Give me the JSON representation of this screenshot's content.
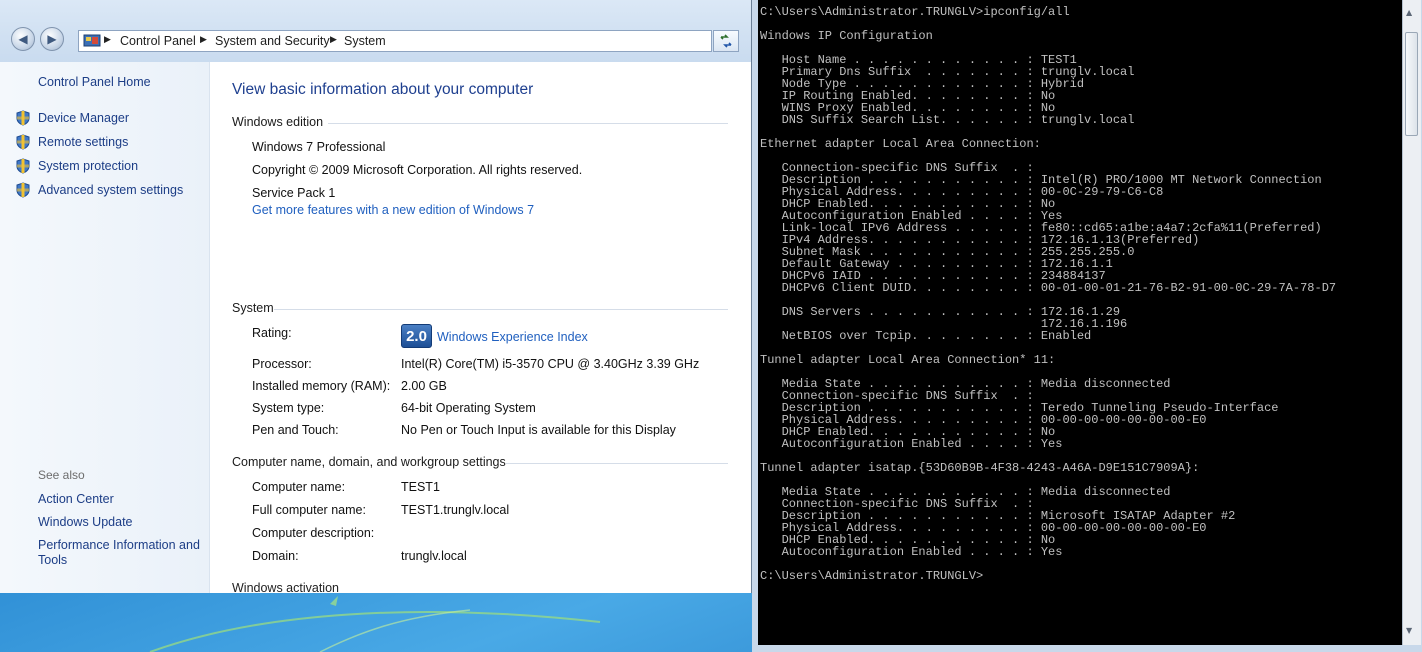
{
  "explorer": {
    "breadcrumb": [
      "Control Panel",
      "System and Security",
      "System"
    ],
    "left_pane": {
      "home": "Control Panel Home",
      "tasks": [
        "Device Manager",
        "Remote settings",
        "System protection",
        "Advanced system settings"
      ],
      "see_also_label": "See also",
      "see_also": [
        "Action Center",
        "Windows Update",
        "Performance Information and",
        "Tools"
      ]
    },
    "main": {
      "title": "View basic information about your computer",
      "windows_edition": {
        "header": "Windows edition",
        "edition": "Windows 7 Professional",
        "copyright": "Copyright © 2009 Microsoft Corporation.  All rights reserved.",
        "service_pack": "Service Pack 1",
        "upgrade_link": "Get more features with a new edition of Windows 7"
      },
      "system": {
        "header": "System",
        "rating_label": "Rating:",
        "rating_value": "2.0",
        "rating_link": "Windows Experience Index",
        "rows": [
          {
            "label": "Processor:",
            "value": "Intel(R) Core(TM) i5-3570 CPU @ 3.40GHz   3.39 GHz"
          },
          {
            "label": "Installed memory (RAM):",
            "value": "2.00 GB"
          },
          {
            "label": "System type:",
            "value": "64-bit Operating System"
          },
          {
            "label": "Pen and Touch:",
            "value": "No Pen or Touch Input is available for this Display"
          }
        ]
      },
      "computer_name": {
        "header": "Computer name, domain, and workgroup settings",
        "rows": [
          {
            "label": "Computer name:",
            "value": "TEST1"
          },
          {
            "label": "Full computer name:",
            "value": "TEST1.trunglv.local"
          },
          {
            "label": "Computer description:",
            "value": ""
          },
          {
            "label": "Domain:",
            "value": "trunglv.local"
          }
        ]
      },
      "activation_cut": "Windows activation"
    }
  },
  "cmd": {
    "lines": [
      "C:\\Users\\Administrator.TRUNGLV>ipconfig/all",
      "",
      "Windows IP Configuration",
      "",
      "   Host Name . . . . . . . . . . . . : TEST1",
      "   Primary Dns Suffix  . . . . . . . : trunglv.local",
      "   Node Type . . . . . . . . . . . . : Hybrid",
      "   IP Routing Enabled. . . . . . . . : No",
      "   WINS Proxy Enabled. . . . . . . . : No",
      "   DNS Suffix Search List. . . . . . : trunglv.local",
      "",
      "Ethernet adapter Local Area Connection:",
      "",
      "   Connection-specific DNS Suffix  . :",
      "   Description . . . . . . . . . . . : Intel(R) PRO/1000 MT Network Connection",
      "   Physical Address. . . . . . . . . : 00-0C-29-79-C6-C8",
      "   DHCP Enabled. . . . . . . . . . . : No",
      "   Autoconfiguration Enabled . . . . : Yes",
      "   Link-local IPv6 Address . . . . . : fe80::cd65:a1be:a4a7:2cfa%11(Preferred)",
      "   IPv4 Address. . . . . . . . . . . : 172.16.1.13(Preferred)",
      "   Subnet Mask . . . . . . . . . . . : 255.255.255.0",
      "   Default Gateway . . . . . . . . . : 172.16.1.1",
      "   DHCPv6 IAID . . . . . . . . . . . : 234884137",
      "   DHCPv6 Client DUID. . . . . . . . : 00-01-00-01-21-76-B2-91-00-0C-29-7A-78-D7",
      "",
      "   DNS Servers . . . . . . . . . . . : 172.16.1.29",
      "                                       172.16.1.196",
      "   NetBIOS over Tcpip. . . . . . . . : Enabled",
      "",
      "Tunnel adapter Local Area Connection* 11:",
      "",
      "   Media State . . . . . . . . . . . : Media disconnected",
      "   Connection-specific DNS Suffix  . :",
      "   Description . . . . . . . . . . . : Teredo Tunneling Pseudo-Interface",
      "   Physical Address. . . . . . . . . : 00-00-00-00-00-00-00-E0",
      "   DHCP Enabled. . . . . . . . . . . : No",
      "   Autoconfiguration Enabled . . . . : Yes",
      "",
      "Tunnel adapter isatap.{53D60B9B-4F38-4243-A46A-D9E151C7909A}:",
      "",
      "   Media State . . . . . . . . . . . : Media disconnected",
      "   Connection-specific DNS Suffix  . :",
      "   Description . . . . . . . . . . . : Microsoft ISATAP Adapter #2",
      "   Physical Address. . . . . . . . . : 00-00-00-00-00-00-00-E0",
      "   DHCP Enabled. . . . . . . . . . . : No",
      "   Autoconfiguration Enabled . . . . : Yes",
      "",
      "C:\\Users\\Administrator.TRUNGLV>"
    ]
  },
  "colors": {
    "link": "#1f5fbf",
    "nav_link": "#1c3d86",
    "title": "#1e3f8f",
    "console_bg": "#000000",
    "console_fg": "#c0c0c0"
  },
  "icons": {
    "back": "back-arrow-icon",
    "forward": "forward-arrow-icon",
    "shield": "uac-shield-icon",
    "refresh": "refresh-icon",
    "control_panel": "control-panel-icon"
  }
}
